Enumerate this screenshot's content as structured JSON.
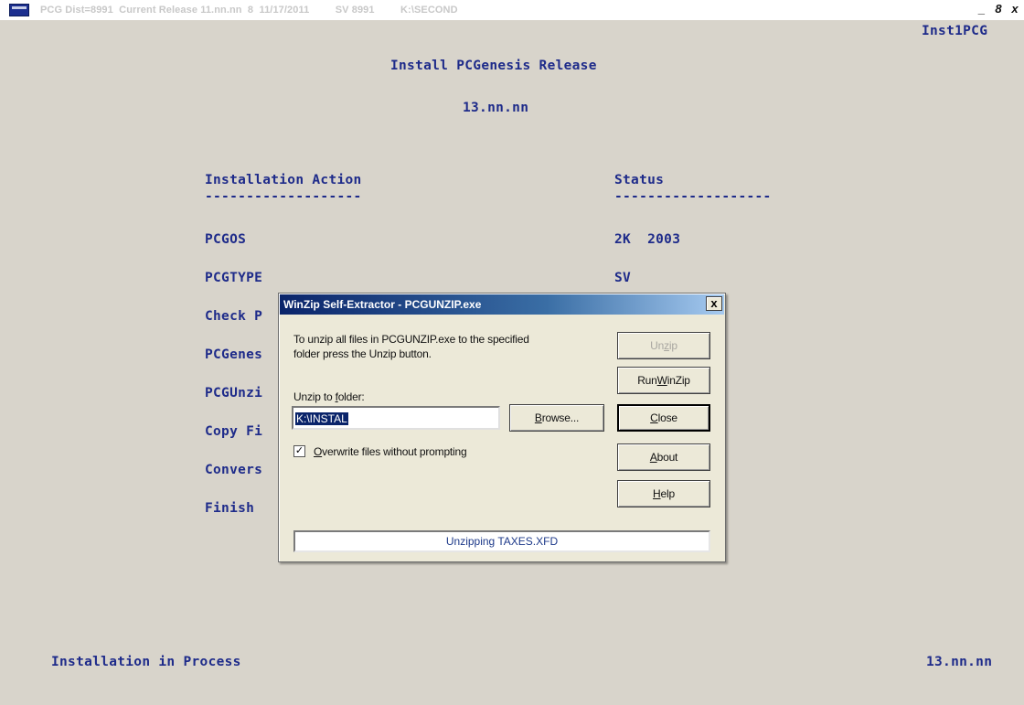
{
  "window": {
    "title": "PCG Dist=8991  Current Release 11.nn.nn  8  11/17/2011         SV 8991         K:\\SECOND",
    "controls": [
      "_",
      "8",
      "x"
    ]
  },
  "screen": {
    "program_id": "Inst1PCG",
    "title": "Install PCGenesis Release",
    "release": "13.nn.nn",
    "col_action_header": "Installation Action",
    "col_status_header": "Status",
    "underline": "-------------------",
    "rows": [
      {
        "action": "PCGOS",
        "status": "2K  2003"
      },
      {
        "action": "PCGTYPE",
        "status": "SV"
      },
      {
        "action": "Check P",
        "status": ""
      },
      {
        "action": "PCGenes",
        "status": ""
      },
      {
        "action": "PCGUnzi",
        "status": ""
      },
      {
        "action": "Copy Fi",
        "status": ""
      },
      {
        "action": "Convers",
        "status": ""
      },
      {
        "action": "Finish",
        "status": ""
      }
    ],
    "footer_left": "Installation in Process",
    "footer_right": "13.nn.nn"
  },
  "dialog": {
    "title": "WinZip Self-Extractor - PCGUNZIP.exe",
    "close": "x",
    "instructions_line1": "To unzip all files in PCGUNZIP.exe to the specified",
    "instructions_line2": "folder press the Unzip button.",
    "folder_label_pre": "Unzip to ",
    "folder_label_key": "f",
    "folder_label_post": "older:",
    "folder_value": "K:\\INSTAL",
    "browse_key": "B",
    "browse_rest": "rowse...",
    "overwrite_checked": "✓",
    "overwrite_key": "O",
    "overwrite_rest": "verwrite files without prompting",
    "unzip_pre": "Un",
    "unzip_key": "z",
    "unzip_post": "ip",
    "run_winzip_pre": "Run ",
    "run_winzip_key": "W",
    "run_winzip_post": "inZip",
    "close_key": "C",
    "close_rest": "lose",
    "about_key": "A",
    "about_rest": "bout",
    "help_key": "H",
    "help_rest": "elp",
    "progress_text": "Unzipping TAXES.XFD"
  }
}
